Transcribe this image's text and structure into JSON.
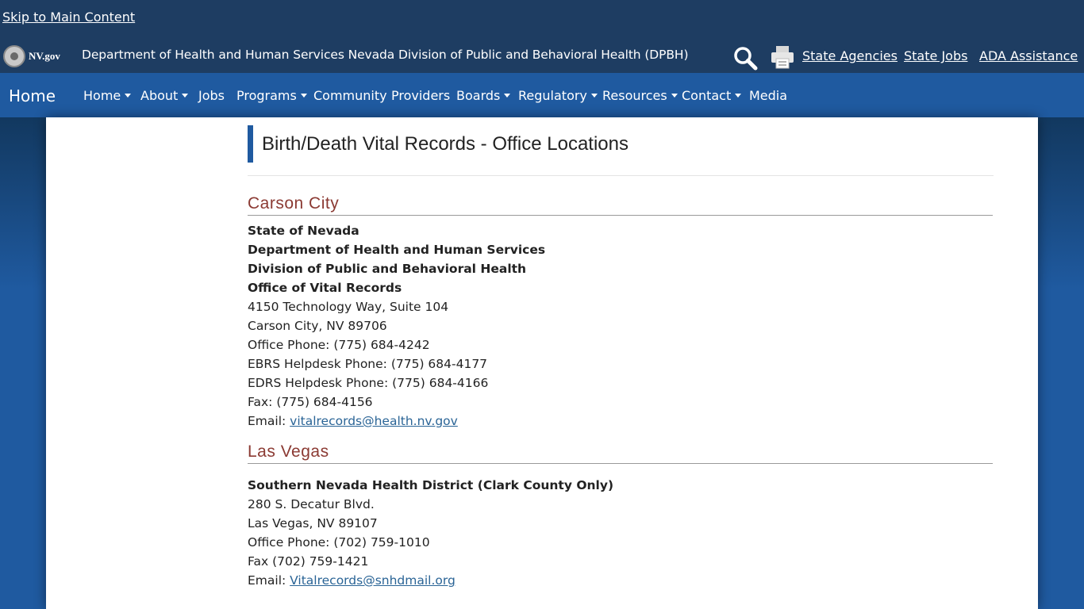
{
  "topbar": {
    "skip_link": "Skip to Main Content",
    "logo_text": "NV.gov",
    "department": "Department of Health and Human Services Nevada Division of Public and Behavioral Health (DPBH)",
    "links": [
      "State Agencies",
      "State Jobs",
      "ADA Assistance"
    ]
  },
  "nav": {
    "brand": "Home",
    "items": [
      {
        "label": "Home"
      },
      {
        "label": "About"
      },
      {
        "label": "Jobs"
      },
      {
        "label": "Programs"
      },
      {
        "label": "Community"
      },
      {
        "label": "Providers"
      },
      {
        "label": "Boards"
      },
      {
        "label": "Regulatory"
      },
      {
        "label": "Resources"
      },
      {
        "label": "Contact"
      },
      {
        "label": "Media"
      }
    ]
  },
  "page": {
    "title": "Birth/Death Vital Records - Office Locations"
  },
  "carson": {
    "heading": "Carson City",
    "org1": "State of Nevada",
    "org2": "Department of Health and Human Services",
    "org3": "Division of Public and Behavioral Health",
    "org4": "Office of Vital Records",
    "address1": "4150 Technology Way, Suite 104",
    "address2": "Carson City, NV 89706",
    "office_phone": "Office Phone: (775) 684-4242",
    "ebrs_phone": "EBRS Helpdesk Phone: (775) 684-4177",
    "edrs_phone": "EDRS Helpdesk Phone: (775) 684-4166",
    "fax": "Fax: (775) 684-4156",
    "email_label": "Email: ",
    "email": "vitalrecords@health.nv.gov"
  },
  "vegas": {
    "heading": "Las Vegas",
    "org": "Southern Nevada Health District (Clark County Only)",
    "address1": "280 S. Decatur Blvd.",
    "address2": "Las Vegas, NV 89107",
    "office_phone": "Office Phone: (702) 759-1010",
    "fax": "Fax (702) 759-1421",
    "email_label": "Email: ",
    "email": "Vitalrecords@snhdmail.org"
  }
}
